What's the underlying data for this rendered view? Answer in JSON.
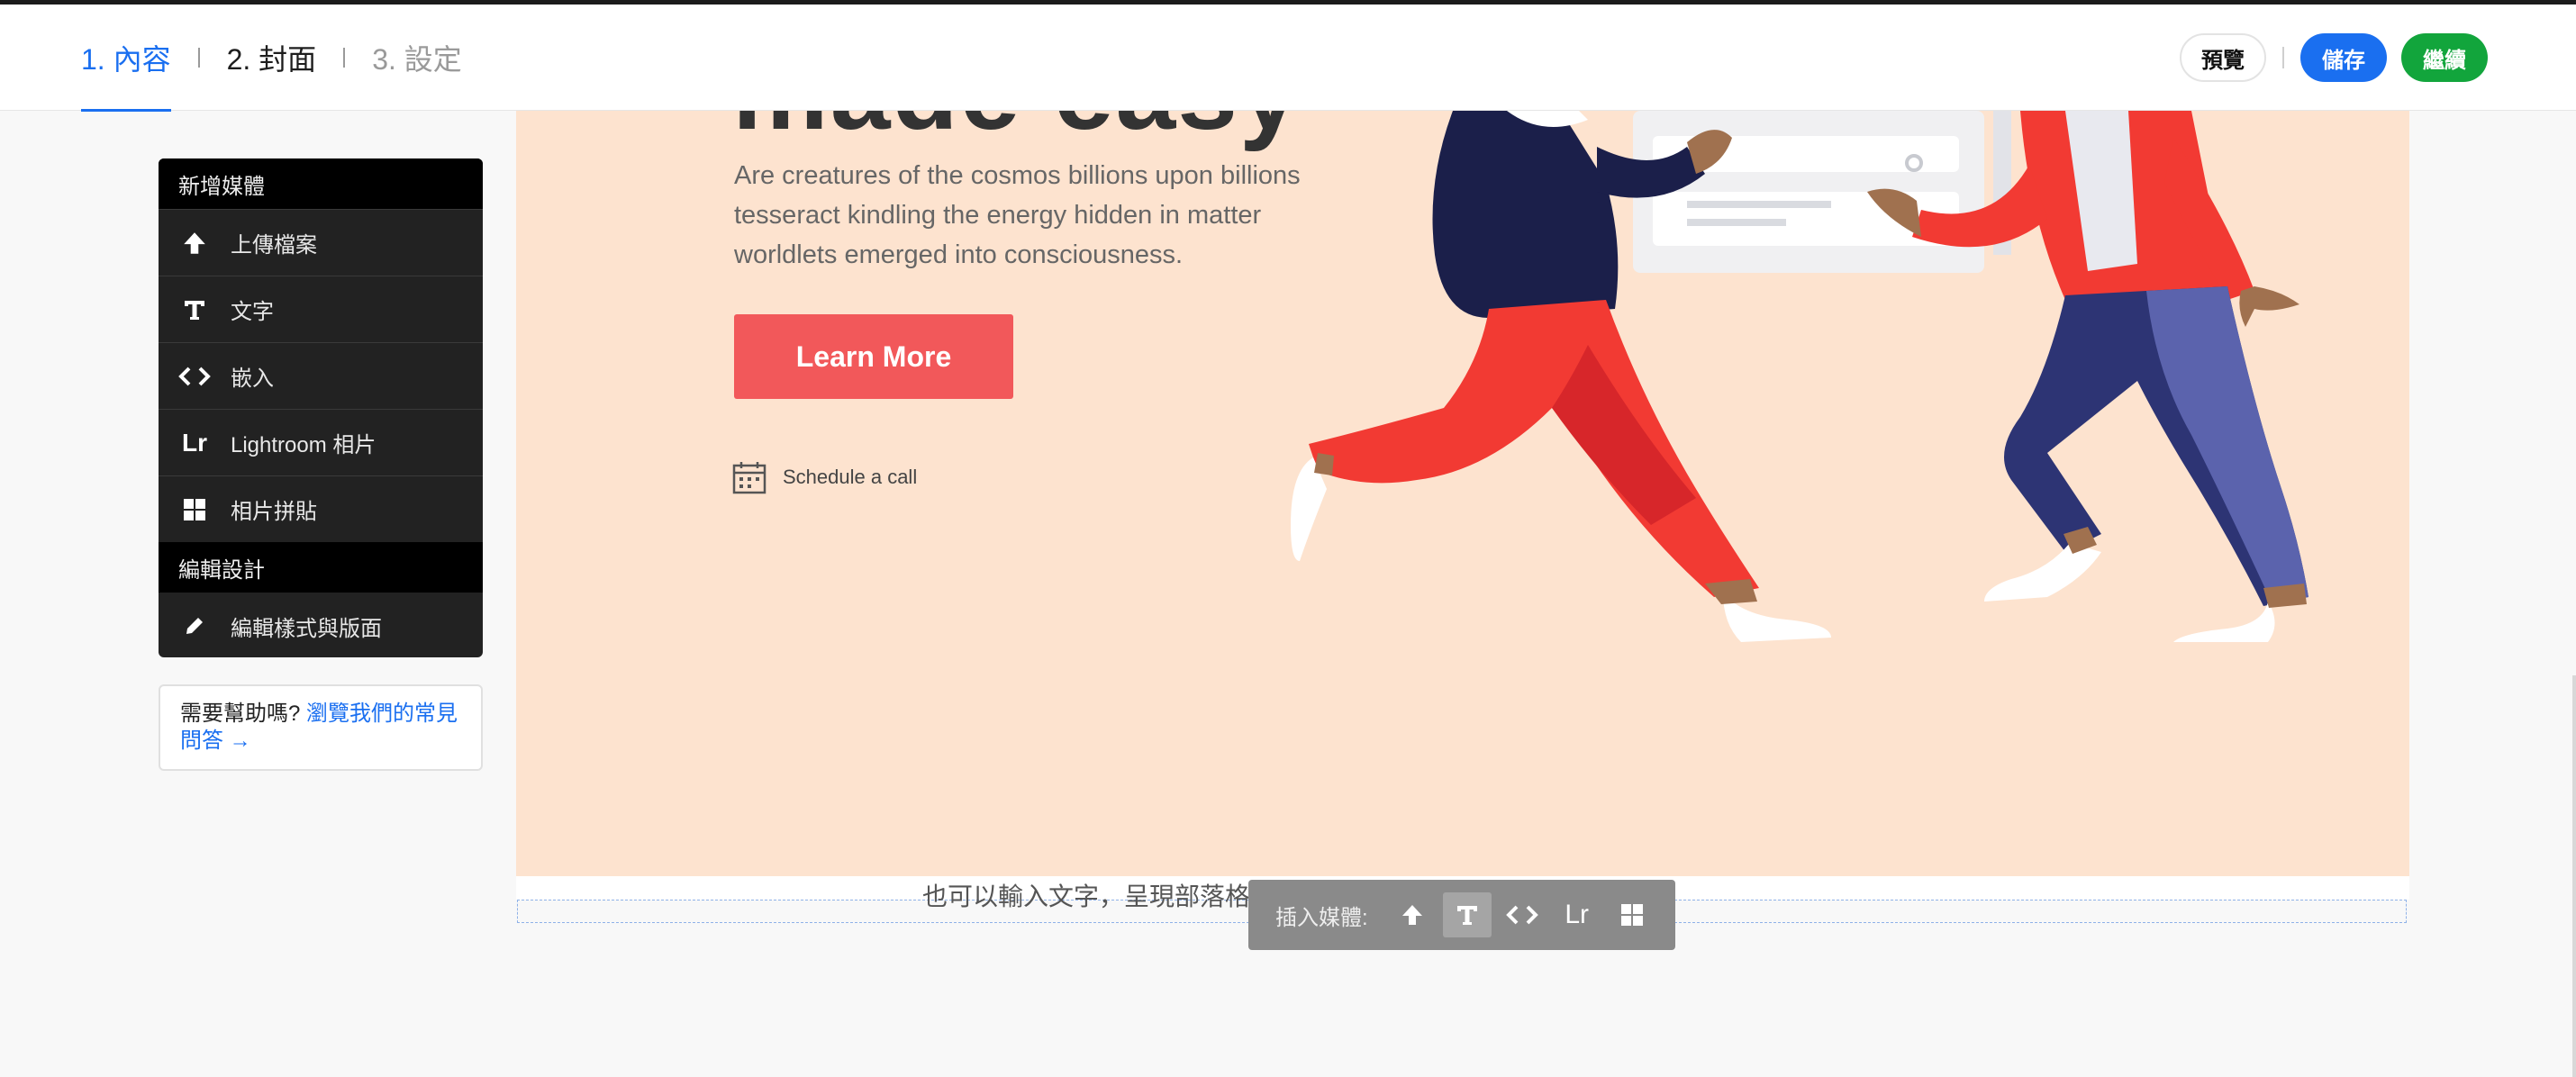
{
  "header": {
    "steps": [
      {
        "label": "1. 內容"
      },
      {
        "label": "2. 封面"
      },
      {
        "label": "3. 設定"
      }
    ],
    "preview_label": "預覽",
    "save_label": "儲存",
    "continue_label": "繼續"
  },
  "sidebar": {
    "add_media_heading": "新增媒體",
    "items": [
      {
        "label": "上傳檔案",
        "icon": "upload-icon"
      },
      {
        "label": "文字",
        "icon": "text-icon"
      },
      {
        "label": "嵌入",
        "icon": "embed-icon"
      },
      {
        "label": "Lightroom 相片",
        "icon": "lightroom-icon"
      },
      {
        "label": "相片拼貼",
        "icon": "grid-icon"
      }
    ],
    "edit_design_heading": "編輯設計",
    "edit_item": {
      "label": "編輯樣式與版面",
      "icon": "pencil-icon"
    }
  },
  "help": {
    "text": "需要幫助嗎?",
    "link": "瀏覽我們的常見問答 →"
  },
  "cover": {
    "title_fragment": "made easy",
    "body": "Are creatures of the cosmos billions upon billions tesseract kindling the energy hidden in matter worldlets emerged into consciousness.",
    "button_label": "Learn More",
    "schedule_label": "Schedule a call"
  },
  "editor": {
    "hint_text": "也可以輸入文字，呈現部落格格風格"
  },
  "toolbar": {
    "label": "插入媒體:",
    "lr_label": "Lr"
  },
  "colors": {
    "accent_blue": "#1a6ff0",
    "continue_green": "#12a53c",
    "cover_bg": "#fde3cf",
    "cta_red": "#f2585a"
  }
}
